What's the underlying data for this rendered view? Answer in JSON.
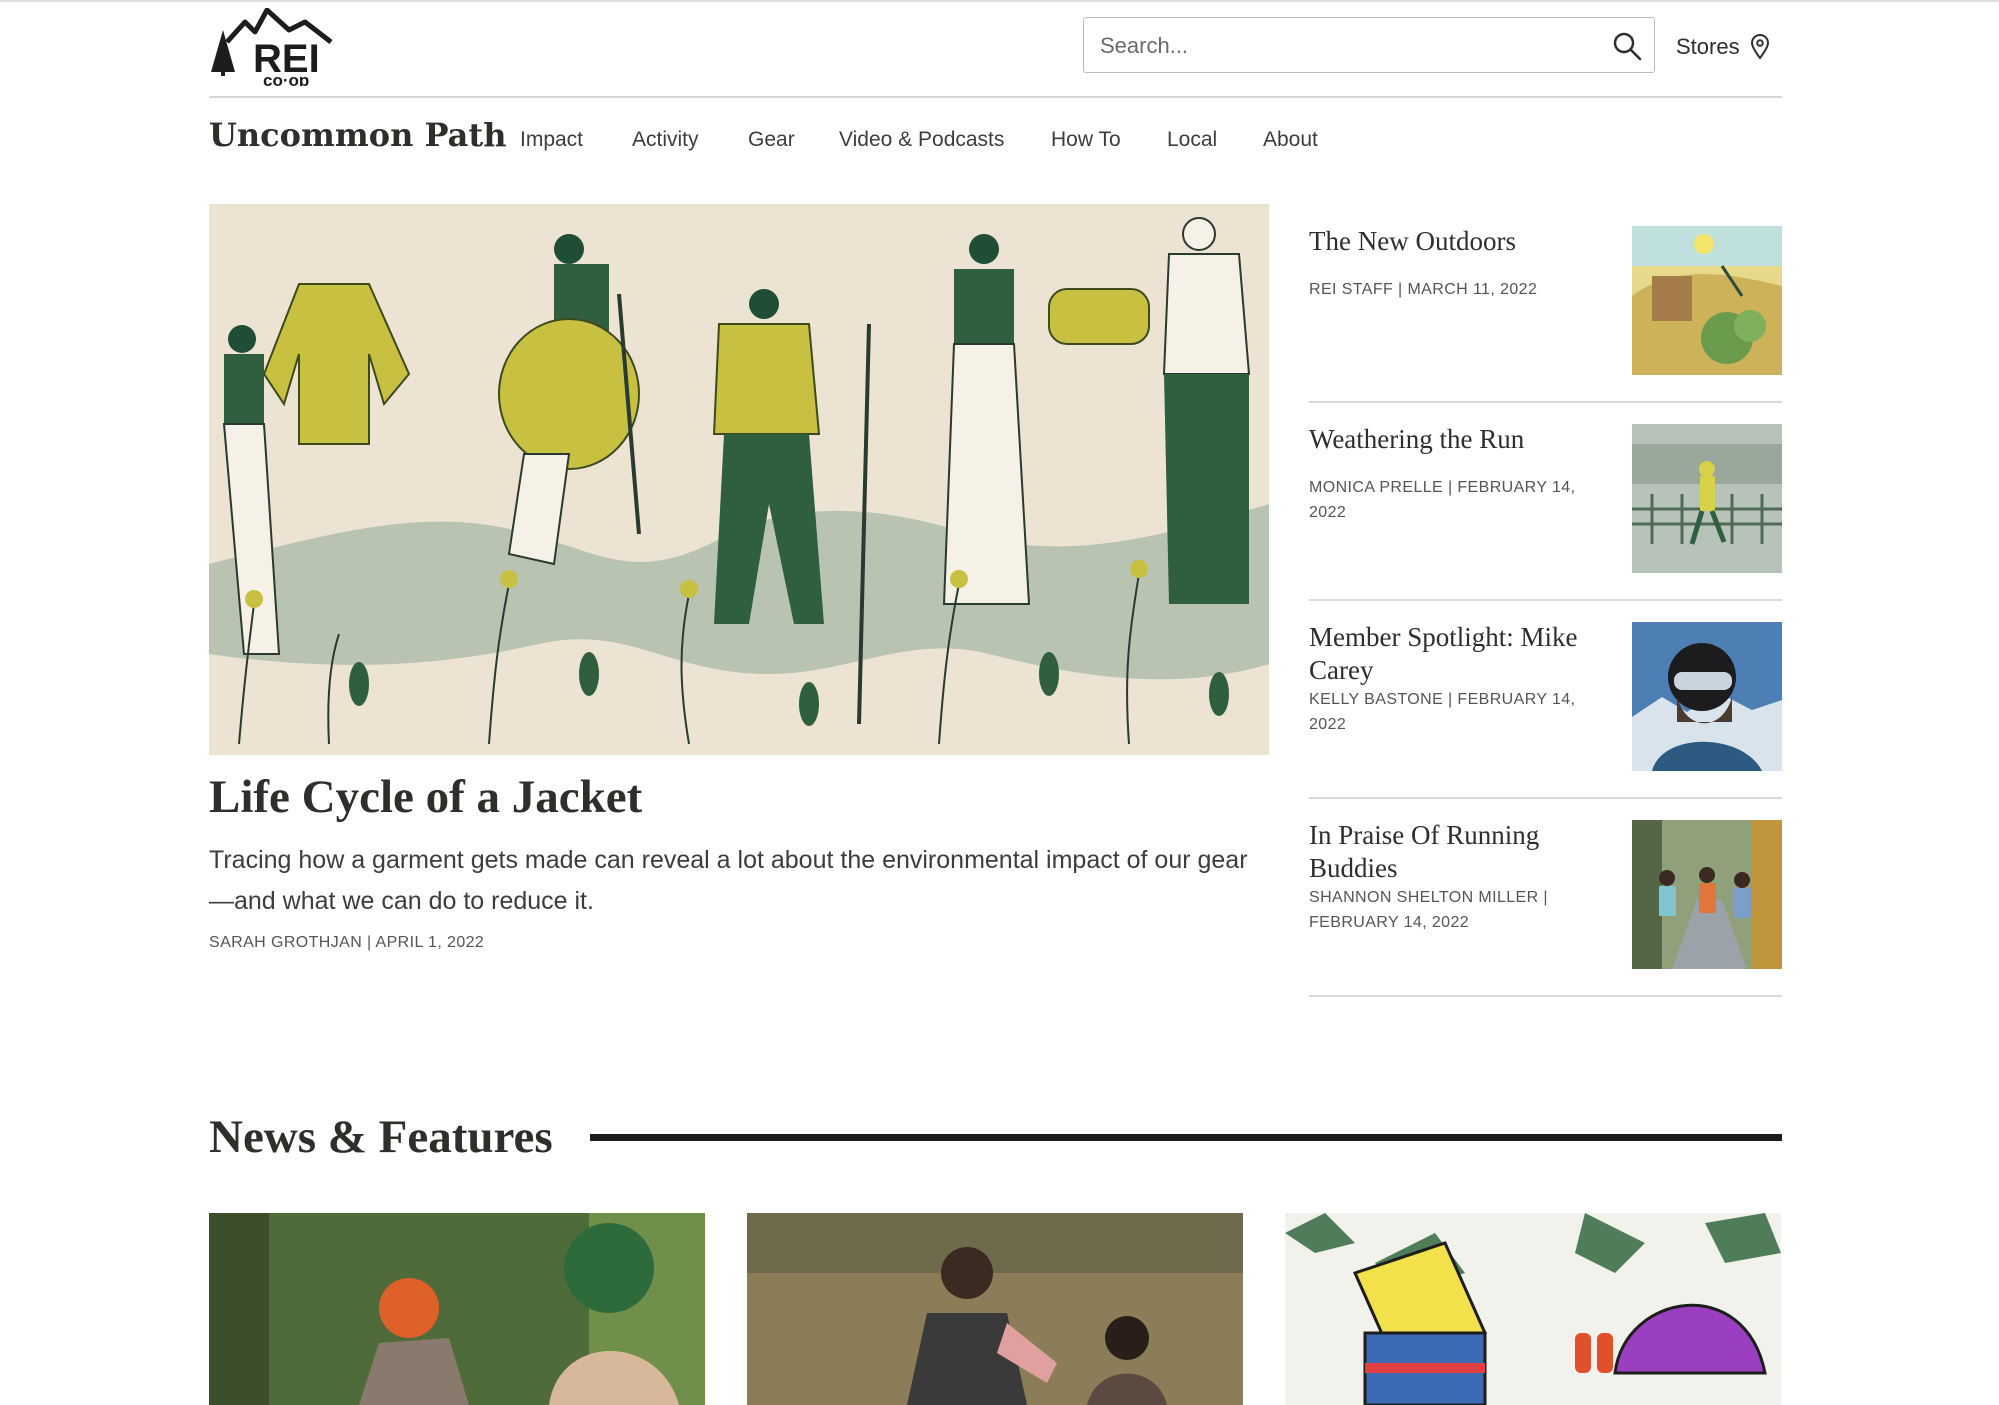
{
  "brand": {
    "logo_text": "REI",
    "logo_subtext": "co·op"
  },
  "header": {
    "search_placeholder": "Search...",
    "stores_label": "Stores"
  },
  "subnav": {
    "site_title": "Uncommon Path",
    "items": [
      "Impact",
      "Activity",
      "Gear",
      "Video & Podcasts",
      "How To",
      "Local",
      "About"
    ]
  },
  "hero": {
    "title": "Life Cycle of a Jacket",
    "description": "Tracing how a garment gets made can reveal a lot about the environmental impact of our gear—and what we can do to reduce it.",
    "meta": "SARAH GROTHJAN | APRIL 1, 2022"
  },
  "side_stories": [
    {
      "title": "The New Outdoors",
      "meta": "REI STAFF | MARCH 11, 2022"
    },
    {
      "title": "Weathering the Run",
      "meta": "MONICA PRELLE | FEBRUARY 14, 2022"
    },
    {
      "title": "Member Spotlight: Mike Carey",
      "meta": "KELLY BASTONE | FEBRUARY 14, 2022"
    },
    {
      "title": "In Praise Of Running Buddies",
      "meta": "SHANNON SHELTON MILLER | FEBRUARY 14, 2022"
    }
  ],
  "news": {
    "title": "News & Features"
  },
  "colors": {
    "text": "#2e2e2b",
    "rule": "#1d1d1b",
    "hero_green": "#2f5f3f",
    "hero_yellow": "#c8c040",
    "hero_bg": "#ece3d3"
  }
}
